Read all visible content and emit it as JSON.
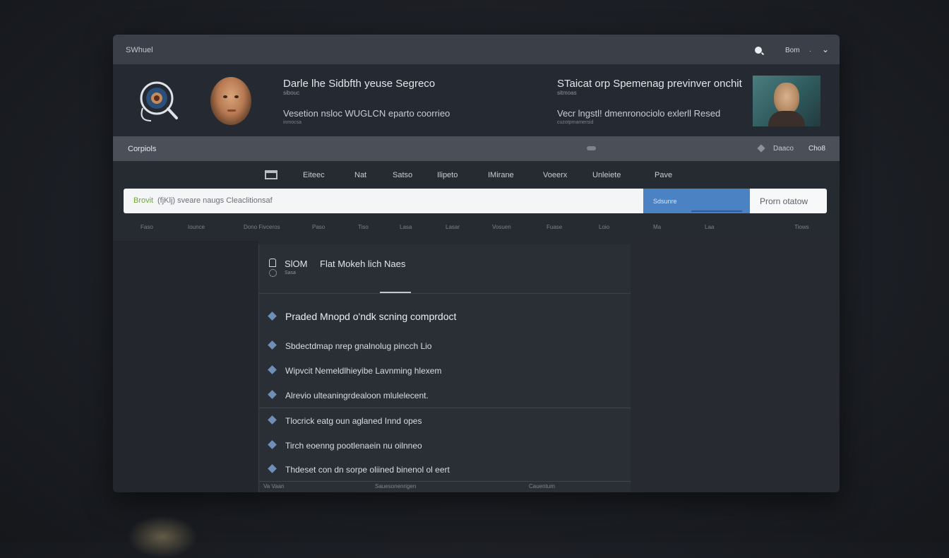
{
  "window": {
    "title": "SWhuel"
  },
  "titlebar": {
    "user_label": "Bom",
    "separator": "."
  },
  "hero": {
    "left_heading": "Darle lhe Sidbfth yeuse Segreco",
    "left_sub": "sibouc",
    "left_line2": "Vesetion nsloc WUGLCN eparto coorrieo",
    "left_line2_sub": "inmocsa",
    "right_heading": "STaicat orp Spemenag previnver onchit",
    "right_sub": "sitmoas",
    "right_line2": "Vecr lngstl! dmenronociolo exlerll Resed",
    "right_line2_sub": "cuzotpmamersid"
  },
  "section": {
    "label": "Corpiols",
    "right_link": "Daaco",
    "right_button": "Cho8"
  },
  "tabs": [
    "Eiteec",
    "Nat",
    "Satso",
    "Ilipeto",
    "IMirane",
    "Voeerx",
    "Unleiete",
    "Pave"
  ],
  "search": {
    "prefix": "Brovit",
    "value": "(fjKlj) sveare naugs  Cleaclitionsaf",
    "primary_button": "Sdsunre",
    "secondary_button": "Prorn otatow"
  },
  "filters": [
    "Faso",
    "Iounce",
    "Dono Fivceros",
    "Paso",
    "Tiso",
    "Lasa",
    "Lasar",
    "Vosuen",
    "Fuase",
    "Loio",
    "Ma",
    "Laa",
    "Tiows"
  ],
  "card": {
    "code": "SlOM",
    "title": "Flat Mokeh lich Naes",
    "sub": "Sasa",
    "rows": [
      "Praded Mnopd o'ndk scning comprdoct",
      "Sbdectdmap nrep gnalnolug pincch Lio",
      "Wipvcit Nemeldlhieyibe Lavnming hlexem",
      "Alrevio ulteaningrdealoon mlulelecent.",
      "Tlocrick eatg oun aglaned Innd opes",
      "Tirch eoenng pootlenaein nu oilnneo",
      "Thdeset con dn sorpe oliined binenol ol eert"
    ],
    "footer": [
      "Va  Vaan",
      "Sauesonenrigen",
      "Cauentum"
    ]
  }
}
